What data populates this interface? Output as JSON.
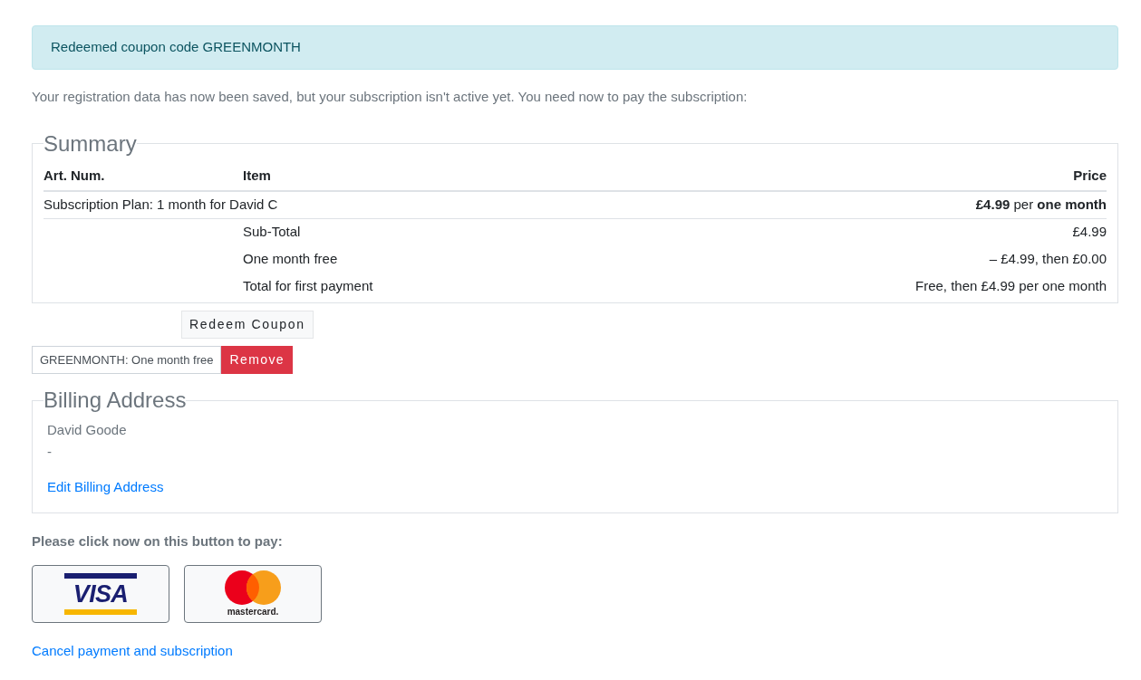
{
  "alert": {
    "text": "Redeemed coupon code GREENMONTH"
  },
  "intro": "Your registration data has now been saved, but your subscription isn't active yet. You need now to pay the subscription:",
  "summary": {
    "legend": "Summary",
    "columns": [
      "Art. Num.",
      "Item",
      "Price"
    ],
    "item_row": {
      "description": "Subscription Plan: 1 month for David C",
      "price": "**£4.99** per **one month**"
    },
    "totals": [
      {
        "label": "Sub-Total",
        "value": "£4.99"
      },
      {
        "label": "One month free",
        "value": "– £4.99, then £0.00"
      },
      {
        "label": "Total for first payment",
        "value": "Free, then £4.99 per one month"
      }
    ]
  },
  "coupon": {
    "redeem_button": "Redeem Coupon",
    "applied": "GREENMONTH: One month free",
    "remove_button": "Remove"
  },
  "billing": {
    "legend": "Billing Address",
    "lines": [
      "David Goode",
      "-"
    ],
    "edit_link": "Edit Billing Address"
  },
  "pay_prompt": "Please click now on this button to pay:",
  "payment_buttons": [
    {
      "kind": "visa",
      "label": "VISA"
    },
    {
      "kind": "mastercard",
      "label": "mastercard."
    }
  ],
  "cancel_link": "Cancel payment and subscription"
}
